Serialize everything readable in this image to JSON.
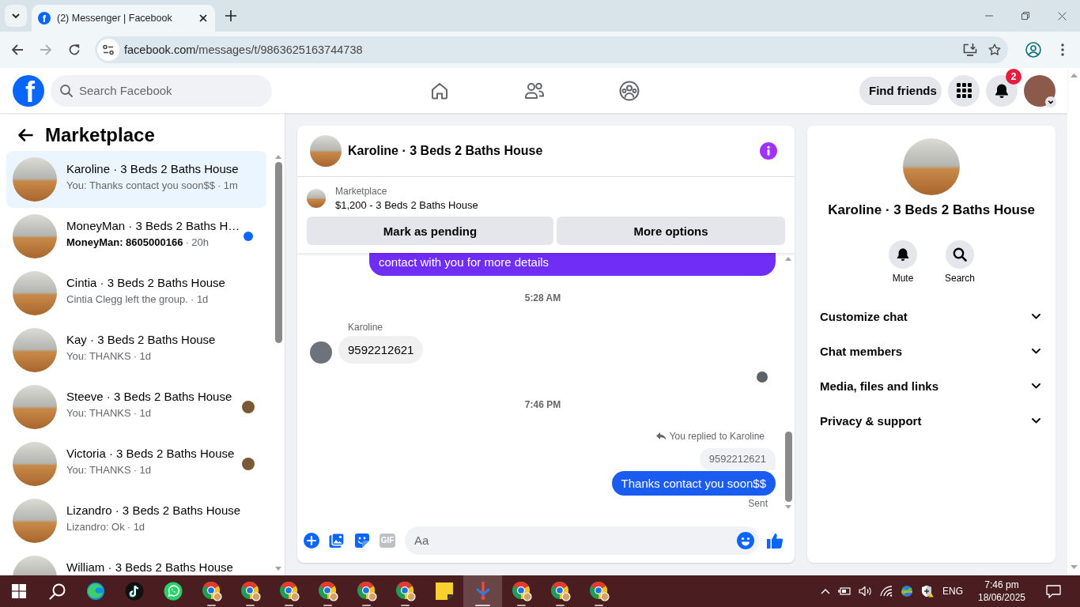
{
  "browser": {
    "tabs": [
      {
        "icon_letter": "f",
        "title": "(2) Messenger | Facebook",
        "selected": true
      }
    ],
    "forward": {
      "disabled": true
    },
    "url": {
      "host": "facebook.com",
      "path": "/messages/t/9863625163744738"
    }
  },
  "header": {
    "logo": "f",
    "search": {
      "placeholder": "Search Facebook"
    },
    "find_friends": "Find friends",
    "notification_count": "2"
  },
  "sidebar": {
    "title": "Marketplace",
    "conversations": [
      {
        "title": "Karoline · 3 Beds 2 Baths House",
        "preview": "You: Thanks contact you soon$$",
        "time": "· 1m",
        "selected": true,
        "unread": false,
        "seen": false
      },
      {
        "title": "MoneyMan · 3 Beds 2 Baths H…",
        "preview": "MoneyMan: 8605000166",
        "time": "· 20h",
        "selected": false,
        "unread": true,
        "seen": false
      },
      {
        "title": "Cintia · 3 Beds 2 Baths House",
        "preview": "Cintia Clegg left the group.",
        "time": "· 1d",
        "selected": false,
        "unread": false,
        "seen": false
      },
      {
        "title": "Kay · 3 Beds 2 Baths House",
        "preview": "You: THANKS",
        "time": "· 1d",
        "selected": false,
        "unread": false,
        "seen": false
      },
      {
        "title": "Steeve · 3 Beds 2 Baths House",
        "preview": "You: THANKS",
        "time": "· 1d",
        "selected": false,
        "unread": false,
        "seen": true
      },
      {
        "title": "Victoria · 3 Beds 2 Baths House",
        "preview": "You: THANKS",
        "time": "· 1d",
        "selected": false,
        "unread": false,
        "seen": true
      },
      {
        "title": "Lizandro · 3 Beds 2 Baths House",
        "preview": "Lizandro: Ok",
        "time": "· 1d",
        "selected": false,
        "unread": false,
        "seen": false
      },
      {
        "title": "William · 3 Beds 2 Baths House",
        "selected": false,
        "unread": false,
        "seen": false
      }
    ]
  },
  "chat": {
    "title": "Karoline · 3 Beds 2 Baths House",
    "listing": {
      "label": "Marketplace",
      "title": "$1,200 - 3 Beds 2 Baths House"
    },
    "actions": [
      "Mark as pending",
      "More options"
    ],
    "messages": [
      {
        "kind": "partial",
        "text": "contact with you for more details",
        "color": "#6f2df6"
      },
      {
        "kind": "timestamp",
        "text": "5:28 AM"
      },
      {
        "kind": "incoming",
        "sender": "Karoline",
        "text": "9592212621"
      },
      {
        "kind": "seen"
      },
      {
        "kind": "timestamp",
        "text": "7:46 PM"
      },
      {
        "kind": "outgoing",
        "reply_label": "You replied to Karoline",
        "quoted": "9592212621",
        "text": "Thanks contact you soon$$",
        "status": "Sent",
        "color": "#1b5cf0"
      }
    ],
    "composer": {
      "placeholder": "Aa",
      "gif_label": "GIF"
    }
  },
  "details": {
    "name": "Karoline · 3 Beds 2 Baths House",
    "actions": [
      {
        "kind": "mute",
        "label": "Mute"
      },
      {
        "kind": "search",
        "label": "Search"
      }
    ],
    "sections": [
      {
        "label": "Customize chat",
        "expanded": false
      },
      {
        "label": "Chat members",
        "expanded": false
      },
      {
        "label": "Media, files and links",
        "expanded": false
      },
      {
        "label": "Privacy & support",
        "expanded": false
      }
    ]
  },
  "taskbar": {
    "apps": [
      {
        "kind": "edge",
        "running": false,
        "selected": false
      },
      {
        "kind": "tiktok",
        "running": false,
        "selected": false
      },
      {
        "kind": "whatsapp",
        "running": false,
        "selected": false
      },
      {
        "kind": "chrome",
        "running": true,
        "selected": false
      },
      {
        "kind": "chrome",
        "running": true,
        "selected": false
      },
      {
        "kind": "chrome",
        "running": true,
        "selected": false
      },
      {
        "kind": "chrome",
        "running": true,
        "selected": false
      },
      {
        "kind": "chrome",
        "running": true,
        "selected": false
      },
      {
        "kind": "chrome",
        "running": true,
        "selected": false
      },
      {
        "kind": "notes",
        "running": false,
        "selected": false
      },
      {
        "kind": "tool",
        "running": true,
        "selected": true
      },
      {
        "kind": "chrome",
        "running": true,
        "selected": false
      },
      {
        "kind": "chrome",
        "running": true,
        "selected": false
      },
      {
        "kind": "chrome",
        "running": true,
        "selected": false
      }
    ],
    "language": "ENG",
    "time": "7:46 pm",
    "date": "18/06/2025"
  }
}
